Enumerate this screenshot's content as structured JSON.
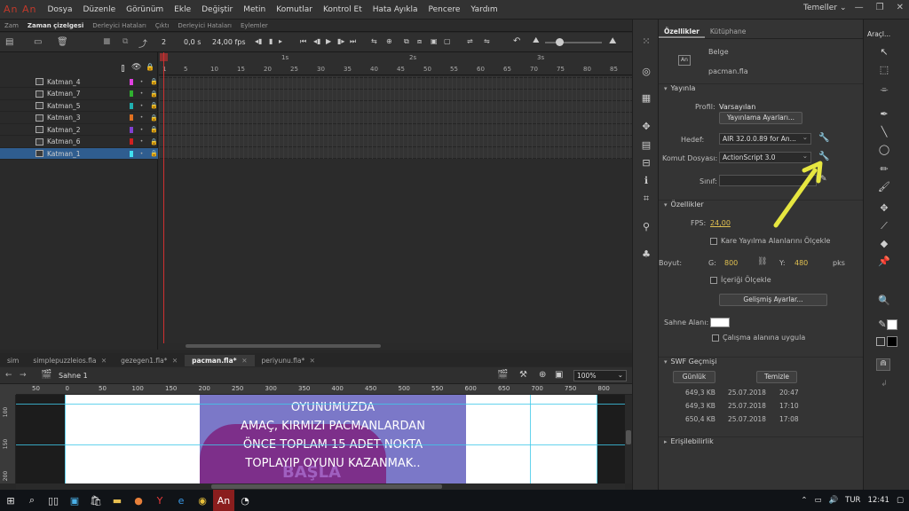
{
  "app": {
    "logo": "An An",
    "workspace_label": "Temeller",
    "workspace_chevron": "⌄",
    "menu": [
      "Dosya",
      "Düzenle",
      "Görünüm",
      "Ekle",
      "Değiştir",
      "Metin",
      "Komutlar",
      "Kontrol Et",
      "Hata Ayıkla",
      "Pencere",
      "Yardım"
    ],
    "window_controls": [
      "—",
      "❐",
      "✕"
    ]
  },
  "timeline": {
    "tabs": [
      "Zam",
      "Zaman çizelgesi",
      "Derleyici Hataları",
      "Çıktı",
      "Derleyici Hataları",
      "Eylemler"
    ],
    "active_tab": 1,
    "frame_current": "2",
    "time": "0,0 s",
    "fps": "24,00 fps",
    "layers": [
      {
        "name": "Katman_4",
        "color": "#e040e0"
      },
      {
        "name": "Katman_7",
        "color": "#30b030"
      },
      {
        "name": "Katman_5",
        "color": "#20b0b0"
      },
      {
        "name": "Katman_3",
        "color": "#e07020"
      },
      {
        "name": "Katman_2",
        "color": "#8040d0"
      },
      {
        "name": "Katman_6",
        "color": "#d02020"
      },
      {
        "name": "Katman_1",
        "color": "#40e0f0"
      }
    ],
    "selected_layer": 6,
    "frame_numbers": [
      "1",
      "5",
      "10",
      "15",
      "20",
      "25",
      "30",
      "35",
      "40",
      "45",
      "50",
      "55",
      "60",
      "65",
      "70",
      "75",
      "80",
      "85"
    ],
    "seconds": [
      "1s",
      "2s",
      "3s"
    ]
  },
  "documents": {
    "tabs": [
      {
        "name": "sim",
        "close": ""
      },
      {
        "name": "simplepuzzleios.fla",
        "close": "✕"
      },
      {
        "name": "gezegen1.fla*",
        "close": "✕"
      },
      {
        "name": "pacman.fla*",
        "close": "✕"
      },
      {
        "name": "periyunu.fla*",
        "close": "✕"
      }
    ],
    "active": 3,
    "scene": "Sahne 1",
    "zoom": "100%",
    "h_ruler": [
      "50",
      "0",
      "50",
      "100",
      "150",
      "200",
      "250",
      "300",
      "350",
      "400",
      "450",
      "500",
      "550",
      "600",
      "650",
      "700",
      "750",
      "800"
    ],
    "v_ruler": [
      "100",
      "150",
      "200"
    ]
  },
  "stage": {
    "text_lines": [
      "OYUNUMUZDA",
      "AMAÇ, KIRMIZI PACMANLARDAN",
      "ÖNCE TOPLAM 15 ADET NOKTA",
      "TOPLAYIP OYUNU KAZANMAK.."
    ],
    "shape_text": "BAŞLA",
    "colors": {
      "purple": "#7b78c8",
      "shape": "#7d2f8a",
      "guide": "#3fc8e8"
    }
  },
  "properties": {
    "tabs": [
      "Özellikler",
      "Kütüphane"
    ],
    "doc_label": "Belge",
    "doc_icon": "An",
    "doc_file": "pacman.fla",
    "publish": {
      "section": "Yayınla",
      "profile_label": "Profil:",
      "profile_value": "Varsayılan",
      "settings_button": "Yayınlama Ayarları...",
      "target_label": "Hedef:",
      "target_value": "AIR 32.0.0.89 for An...",
      "script_label": "Komut Dosyası:",
      "script_value": "ActionScript 3.0",
      "class_label": "Sınıf:",
      "class_value": ""
    },
    "props": {
      "section": "Özellikler",
      "fps_label": "FPS:",
      "fps_value": "24,00",
      "scale_spans_label": "Kare Yayılma Alanlarını Ölçekle",
      "size_label": "Boyut:",
      "g_label": "G:",
      "width": "800",
      "y_label": "Y:",
      "height": "480",
      "unit": "pks",
      "scale_content_label": "İçeriği Ölçekle",
      "advanced_button": "Gelişmiş Ayarlar..."
    },
    "stage_label": "Sahne Alanı:",
    "stage_color": "#ffffff",
    "fit_workspace_label": "Çalışma alanına uygula",
    "swf": {
      "section": "SWF Geçmişi",
      "log_button": "Günlük",
      "clear_button": "Temizle",
      "rows": [
        {
          "size": "649,3 KB",
          "date": "25.07.2018",
          "time": "20:47"
        },
        {
          "size": "649,3 KB",
          "date": "25.07.2018",
          "time": "17:10"
        },
        {
          "size": "650,4 KB",
          "date": "25.07.2018",
          "time": "17:08"
        }
      ]
    },
    "accessibility": "Erişilebilirlik"
  },
  "tools": {
    "title": "Araçl...",
    "arrow_color": "#e6e640"
  },
  "taskbar": {
    "icons": [
      "windows-logo",
      "search-icon",
      "task-view-icon",
      "store-icon",
      "bag-icon",
      "folder-icon",
      "firefox-icon",
      "yandex-icon",
      "edge-icon",
      "chrome-icon",
      "animate-icon",
      "other-app-icon"
    ],
    "language": "TUR",
    "clock": "12:41"
  }
}
